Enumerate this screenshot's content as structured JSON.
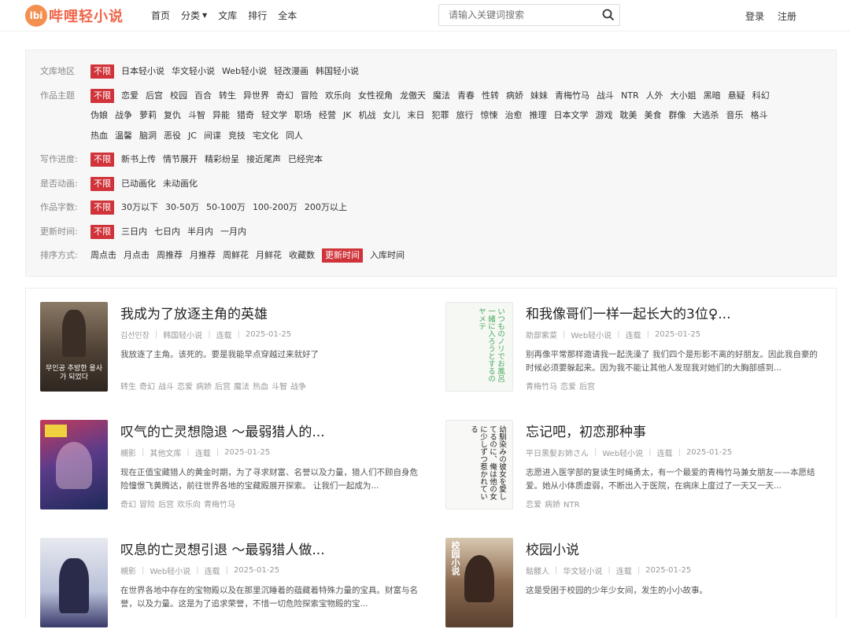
{
  "header": {
    "logo_badge": "lbi",
    "logo_text": "哔哩轻小说",
    "nav": [
      "首页",
      "分类",
      "文库",
      "排行",
      "全本"
    ],
    "search_placeholder": "请输入关键词搜索",
    "login": "登录",
    "register": "注册"
  },
  "filters": [
    {
      "label": "文库地区",
      "options": [
        "不限",
        "日本轻小说",
        "华文轻小说",
        "Web轻小说",
        "轻改漫画",
        "韩国轻小说"
      ],
      "active": "不限"
    },
    {
      "label": "作品主题",
      "options": [
        "不限",
        "恋爱",
        "后宫",
        "校园",
        "百合",
        "转生",
        "异世界",
        "奇幻",
        "冒险",
        "欢乐向",
        "女性视角",
        "龙傲天",
        "魔法",
        "青春",
        "性转",
        "病娇",
        "妹妹",
        "青梅竹马",
        "战斗",
        "NTR",
        "人外",
        "大小姐",
        "黑暗",
        "悬疑",
        "科幻",
        "伪娘",
        "战争",
        "萝莉",
        "复仇",
        "斗智",
        "异能",
        "猎奇",
        "轻文学",
        "职场",
        "经营",
        "JK",
        "机战",
        "女儿",
        "末日",
        "犯罪",
        "旅行",
        "惊悚",
        "治愈",
        "推理",
        "日本文学",
        "游戏",
        "耽美",
        "美食",
        "群像",
        "大逃杀",
        "音乐",
        "格斗",
        "热血",
        "温馨",
        "脑洞",
        "恶役",
        "JC",
        "间谍",
        "竞技",
        "宅文化",
        "同人"
      ],
      "active": "不限"
    },
    {
      "label": "写作进度:",
      "options": [
        "不限",
        "新书上传",
        "情节展开",
        "精彩纷呈",
        "接近尾声",
        "已经完本"
      ],
      "active": "不限"
    },
    {
      "label": "是否动画:",
      "options": [
        "不限",
        "已动画化",
        "未动画化"
      ],
      "active": "不限"
    },
    {
      "label": "作品字数:",
      "options": [
        "不限",
        "30万以下",
        "30-50万",
        "50-100万",
        "100-200万",
        "200万以上"
      ],
      "active": "不限"
    },
    {
      "label": "更新时间:",
      "options": [
        "不限",
        "三日内",
        "七日内",
        "半月内",
        "一月内"
      ],
      "active": "不限"
    },
    {
      "label": "排序方式:",
      "options": [
        "周点击",
        "月点击",
        "周推荐",
        "月推荐",
        "周鲜花",
        "月鲜花",
        "收藏数",
        "更新时间",
        "入库时间"
      ],
      "active": "更新时间"
    }
  ],
  "books": [
    {
      "title": "我成为了放逐主角的英雄",
      "author": "김선인장",
      "library": "韩国轻小说",
      "status": "连载",
      "date": "2025-01-25",
      "desc": "我放逐了主角。该死的。要是我能早点穿越过来就好了",
      "tags": [
        "转生",
        "奇幻",
        "战斗",
        "恋爱",
        "病娇",
        "后宫",
        "魔法",
        "热血",
        "斗智",
        "战争"
      ],
      "cover_color": "#5a4a3c"
    },
    {
      "title": "和我像哥们一样一起长大的3位♀...",
      "author": "助部紫菜",
      "library": "Web轻小说",
      "status": "连载",
      "date": "2025-01-25",
      "desc": "别再像平常那样邀请我一起洗澡了 我们四个是形影不离的好朋友。因此我自豪的时候必须要躲起来。因为我不能让其他人发现我对她们的大胸部感到...",
      "tags": [
        "青梅竹马",
        "恋爱",
        "后宫"
      ],
      "cover_color": "#f6f8f4"
    },
    {
      "title": "叹气的亡灵想隐退 ～最弱猎人的...",
      "author": "槻影",
      "library": "其他文库",
      "status": "连载",
      "date": "2025-01-25",
      "desc": "现在正值宝藏猎人的黄金时期，为了寻求财富、名誉以及力量，猎人们不顾自身危险憧憬飞黄腾达，前往世界各地的宝藏殿展开探索。 让我们一起成为...",
      "tags": [
        "奇幻",
        "冒险",
        "后宫",
        "欢乐向",
        "青梅竹马"
      ],
      "cover_color": "#4a3a6a"
    },
    {
      "title": "忘记吧，初恋那种事",
      "author": "平日黒髪お姉さん",
      "library": "Web轻小说",
      "status": "连载",
      "date": "2025-01-25",
      "desc": "志愿进入医学部的复读生时绳勇太，有一个最爱的青梅竹马兼女朋友——本愿结爱。她从小体质虚弱，不断出入于医院，在病床上度过了一天又一天...",
      "tags": [
        "恋爱",
        "病娇",
        "NTR"
      ],
      "cover_color": "#f8f8f6"
    },
    {
      "title": "叹息的亡灵想引退 ～最弱猎人做...",
      "author": "槻影",
      "library": "Web轻小说",
      "status": "连载",
      "date": "2025-01-25",
      "desc": "在世界各地中存在的宝物殿以及在那里沉睡着的蕴藏着特殊力量的宝具。财富与名誉，以及力量。这是为了追求荣誉，不惜一切危险探索宝物殿的宝...",
      "tags": [],
      "cover_color": "#e6e8ee"
    },
    {
      "title": "校园小说",
      "author": "骷髅人",
      "library": "华文轻小说",
      "status": "连载",
      "date": "2025-01-25",
      "desc": "这是受困于校园的少年少女间，发生的小小故事。",
      "tags": [],
      "cover_color": "#6b5a4a"
    }
  ],
  "cover_texts": {
    "b1": "무인공 추방한 용사가 되었다",
    "b2": "いつものノリでお風呂一緒に入ろうとするのヤメテ",
    "b4": "幼馴染みの彼女を愛してるのに、俺は他の女に少しずつ惹かれている",
    "b6": "校园小说"
  }
}
